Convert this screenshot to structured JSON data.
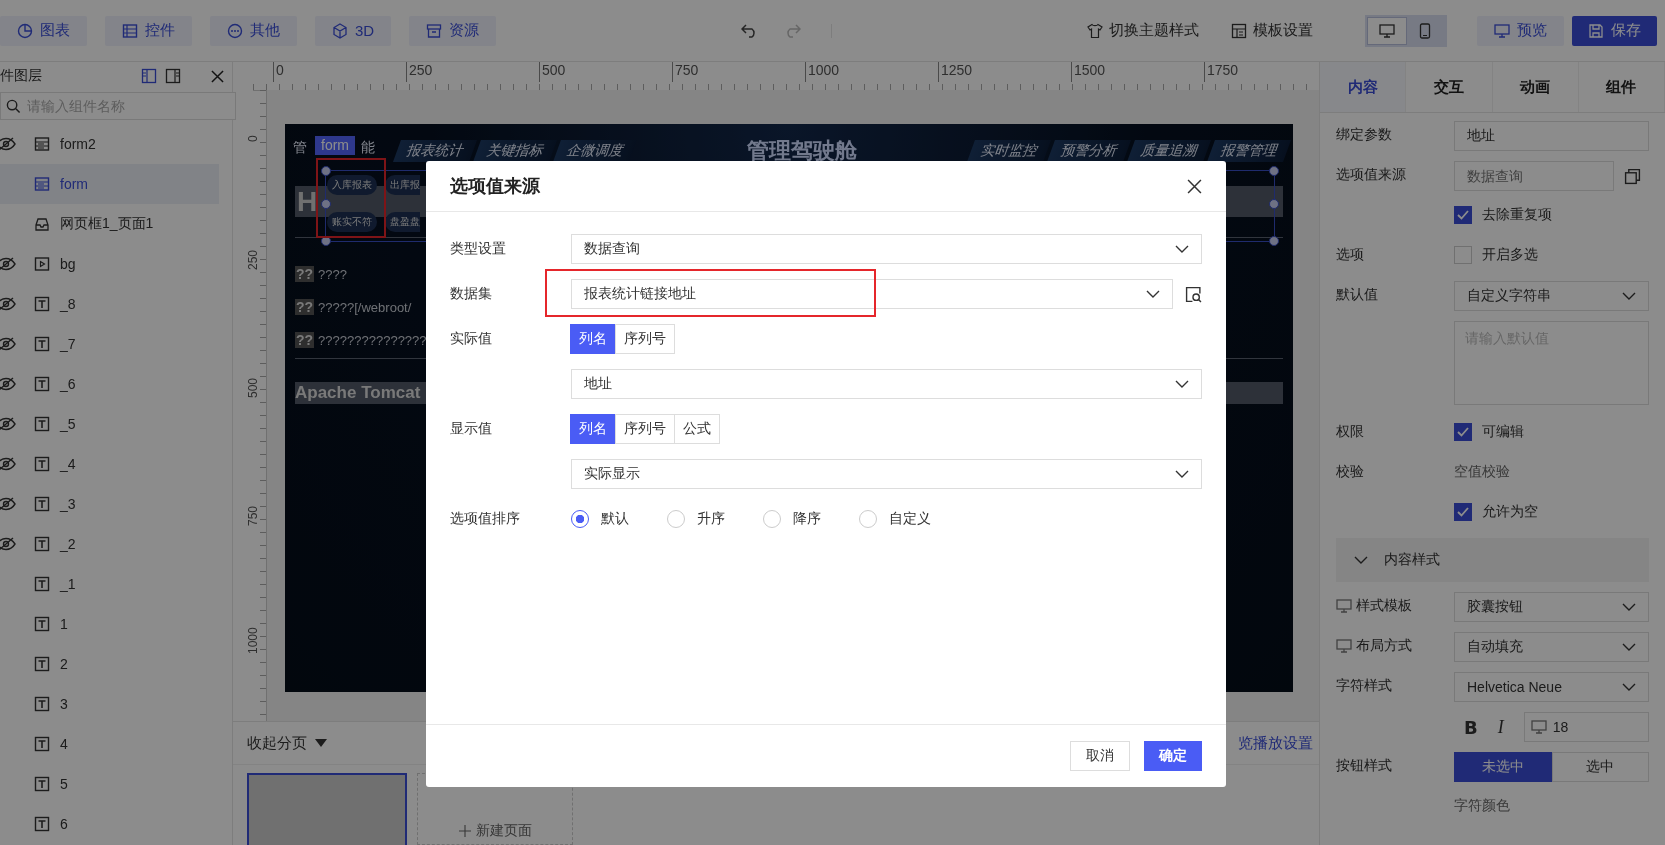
{
  "toolbar": {
    "left_buttons": [
      {
        "label": "图表",
        "kind": "chart"
      },
      {
        "label": "控件",
        "kind": "control"
      },
      {
        "label": "其他",
        "kind": "other"
      },
      {
        "label": "3D",
        "kind": "cube"
      },
      {
        "label": "资源",
        "kind": "box"
      }
    ],
    "theme_button": "切换主题样式",
    "template_button": "模板设置",
    "devices": [
      {
        "kind": "desktop",
        "selected": true
      },
      {
        "kind": "mobile",
        "selected": false
      }
    ],
    "preview_button": "预览",
    "save_button": "保存"
  },
  "layers_panel": {
    "title": "件图层",
    "search": {
      "placeholder": "请输入组件名称"
    },
    "items": [
      {
        "name": "form2",
        "kind": "form",
        "hidden": true,
        "selected": false
      },
      {
        "name": "form",
        "kind": "form",
        "hidden": false,
        "selected": true
      },
      {
        "name": "网页框1_页面1",
        "kind": "frame",
        "hidden": false,
        "selected": false
      },
      {
        "name": "bg",
        "kind": "video",
        "hidden": true,
        "selected": false
      },
      {
        "name": "_8",
        "kind": "text",
        "hidden": true,
        "selected": false
      },
      {
        "name": "_7",
        "kind": "text",
        "hidden": true,
        "selected": false
      },
      {
        "name": "_6",
        "kind": "text",
        "hidden": true,
        "selected": false
      },
      {
        "name": "_5",
        "kind": "text",
        "hidden": true,
        "selected": false
      },
      {
        "name": "_4",
        "kind": "text",
        "hidden": true,
        "selected": false
      },
      {
        "name": "_3",
        "kind": "text",
        "hidden": true,
        "selected": false
      },
      {
        "name": "_2",
        "kind": "text",
        "hidden": true,
        "selected": false
      },
      {
        "name": "_1",
        "kind": "text",
        "hidden": false,
        "selected": false
      },
      {
        "name": "1",
        "kind": "text",
        "hidden": false,
        "selected": false
      },
      {
        "name": "2",
        "kind": "text",
        "hidden": false,
        "selected": false
      },
      {
        "name": "3",
        "kind": "text",
        "hidden": false,
        "selected": false
      },
      {
        "name": "4",
        "kind": "text",
        "hidden": false,
        "selected": false
      },
      {
        "name": "5",
        "kind": "text",
        "hidden": false,
        "selected": false
      },
      {
        "name": "6",
        "kind": "text",
        "hidden": false,
        "selected": false
      }
    ]
  },
  "rulers": {
    "x_ticks": [
      "0",
      "250",
      "500",
      "750",
      "1000",
      "1250",
      "1500",
      "1750"
    ],
    "y_ticks": [
      "0",
      "250",
      "500",
      "750",
      "1000"
    ]
  },
  "canvas": {
    "nav_fragments": [
      "管",
      "能"
    ],
    "selection_tag": "form",
    "nav_left": [
      "报表统计",
      "关键指标",
      "企微调度"
    ],
    "title": "管理驾驶舱",
    "nav_right": [
      "实时监控",
      "预警分析",
      "质量追溯",
      "报警管理"
    ],
    "form_buttons": [
      "入库报表",
      "出库报",
      "账实不符",
      "盘盈盘"
    ],
    "heading": "H",
    "lines": [
      {
        "mark": "??",
        "text": "????"
      },
      {
        "mark": "??",
        "text": "?????[/webroot/"
      },
      {
        "mark": "??",
        "text": "???????????????"
      }
    ],
    "footer_heading": "Apache Tomcat"
  },
  "pages_bar": {
    "collapse_label": "收起分页",
    "settings_link": "览播放设置",
    "new_page": "新建页面",
    "pages": [
      {
        "selected": true
      }
    ]
  },
  "properties_panel": {
    "tabs": [
      {
        "label": "内容",
        "selected": true
      },
      {
        "label": "交互",
        "selected": false
      },
      {
        "label": "动画",
        "selected": false
      },
      {
        "label": "组件",
        "selected": false
      }
    ],
    "rows": [
      {
        "kind": "input",
        "label": "绑定参数",
        "value": "地址",
        "disabled": false
      },
      {
        "kind": "input_copy",
        "label": "选项值来源",
        "placeholder": "数据查询"
      },
      {
        "kind": "checkbox",
        "text": "去除重复项",
        "checked": true
      },
      {
        "kind": "checkbox",
        "label": "选项",
        "text": "开启多选",
        "checked": false
      },
      {
        "kind": "select",
        "label": "默认值",
        "value": "自定义字符串",
        "device_icon": false
      },
      {
        "kind": "textarea",
        "placeholder": "请输入默认值"
      },
      {
        "kind": "checkbox",
        "label": "权限",
        "text": "可编辑",
        "checked": true
      },
      {
        "kind": "caption",
        "label": "校验",
        "text": "空值校验"
      },
      {
        "kind": "checkbox",
        "text": "允许为空",
        "checked": true
      },
      {
        "kind": "section",
        "text": "内容样式",
        "expanded": true
      },
      {
        "kind": "select",
        "label": "样式模板",
        "value": "胶囊按钮",
        "device_icon": true
      },
      {
        "kind": "select",
        "label": "布局方式",
        "value": "自动填充",
        "device_icon": true
      },
      {
        "kind": "select",
        "label": "字符样式",
        "value": "Helvetica Neue",
        "device_icon": false
      },
      {
        "kind": "font_tools",
        "bold": "B",
        "italic": "I",
        "size": "18"
      },
      {
        "kind": "segmented",
        "label": "按钮样式",
        "options": [
          {
            "label": "未选中",
            "selected": true
          },
          {
            "label": "选中",
            "selected": false
          }
        ]
      },
      {
        "kind": "caption",
        "text": "字符颜色"
      }
    ]
  },
  "dialog": {
    "title": "选项值来源",
    "rows": [
      {
        "kind": "select",
        "label": "类型设置",
        "value": "数据查询",
        "preview": false,
        "highlighted": false
      },
      {
        "kind": "select",
        "label": "数据集",
        "value": "报表统计链接地址",
        "preview": true,
        "highlighted": true
      },
      {
        "kind": "segmented",
        "label": "实际值",
        "options": [
          {
            "label": "列名",
            "selected": true
          },
          {
            "label": "序列号",
            "selected": false
          }
        ]
      },
      {
        "kind": "select",
        "value": "地址",
        "preview": false,
        "highlighted": false
      },
      {
        "kind": "segmented",
        "label": "显示值",
        "options": [
          {
            "label": "列名",
            "selected": true
          },
          {
            "label": "序列号",
            "selected": false
          },
          {
            "label": "公式",
            "selected": false
          }
        ]
      },
      {
        "kind": "select",
        "value": "实际显示",
        "preview": false,
        "highlighted": false
      },
      {
        "kind": "radios",
        "label": "选项值排序",
        "options": [
          {
            "label": "默认",
            "selected": true
          },
          {
            "label": "升序",
            "selected": false
          },
          {
            "label": "降序",
            "selected": false
          },
          {
            "label": "自定义",
            "selected": false
          }
        ]
      }
    ],
    "cancel": "取消",
    "confirm": "确定"
  }
}
